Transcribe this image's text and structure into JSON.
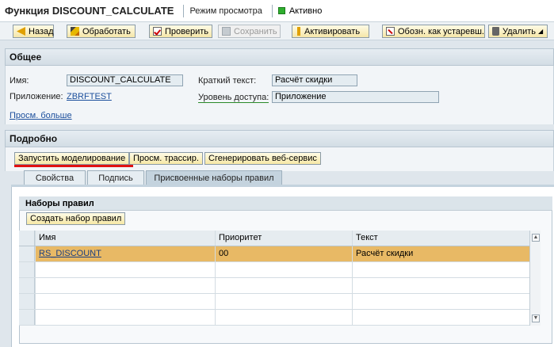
{
  "header": {
    "title": "Функция DISCOUNT_CALCULATE",
    "mode": "Режим просмотра",
    "status": "Активно",
    "status_color": "#2fae2f"
  },
  "toolbar": {
    "back": "Назад",
    "edit": "Обработать",
    "check": "Проверить",
    "save": "Сохранить",
    "activate": "Активировать",
    "obsolete": "Обозн. как устаревш.",
    "delete": "Удалить"
  },
  "general": {
    "section_title": "Общее",
    "name_label": "Имя:",
    "name_value": "DISCOUNT_CALCULATE",
    "short_text_label": "Краткий текст:",
    "short_text_value": "Расчёт скидки",
    "application_label": "Приложение:",
    "application_value": "ZBRFTEST",
    "access_level_label": "Уровень доступа:",
    "access_level_value": "Приложение",
    "show_more": "Просм. больше"
  },
  "details": {
    "section_title": "Подробно",
    "buttons": {
      "simulate": "Запустить моделирование",
      "trace": "Просм. трассир.",
      "webservice": "Сгенерировать веб-сервис"
    },
    "tabs": [
      "Свойства",
      "Подпись",
      "Присвоенные наборы правил"
    ],
    "active_tab": "Присвоенные наборы правил"
  },
  "rulesets": {
    "group_title": "Наборы правил",
    "create_button": "Создать набор правил",
    "columns": [
      "Имя",
      "Приоритет",
      "Текст"
    ],
    "rows": [
      {
        "name": "RS_DISCOUNT",
        "priority": "00",
        "text": "Расчёт скидки"
      }
    ]
  },
  "colors": {
    "selected_row": "#e8b965",
    "highlight_underline": "#e01010"
  }
}
